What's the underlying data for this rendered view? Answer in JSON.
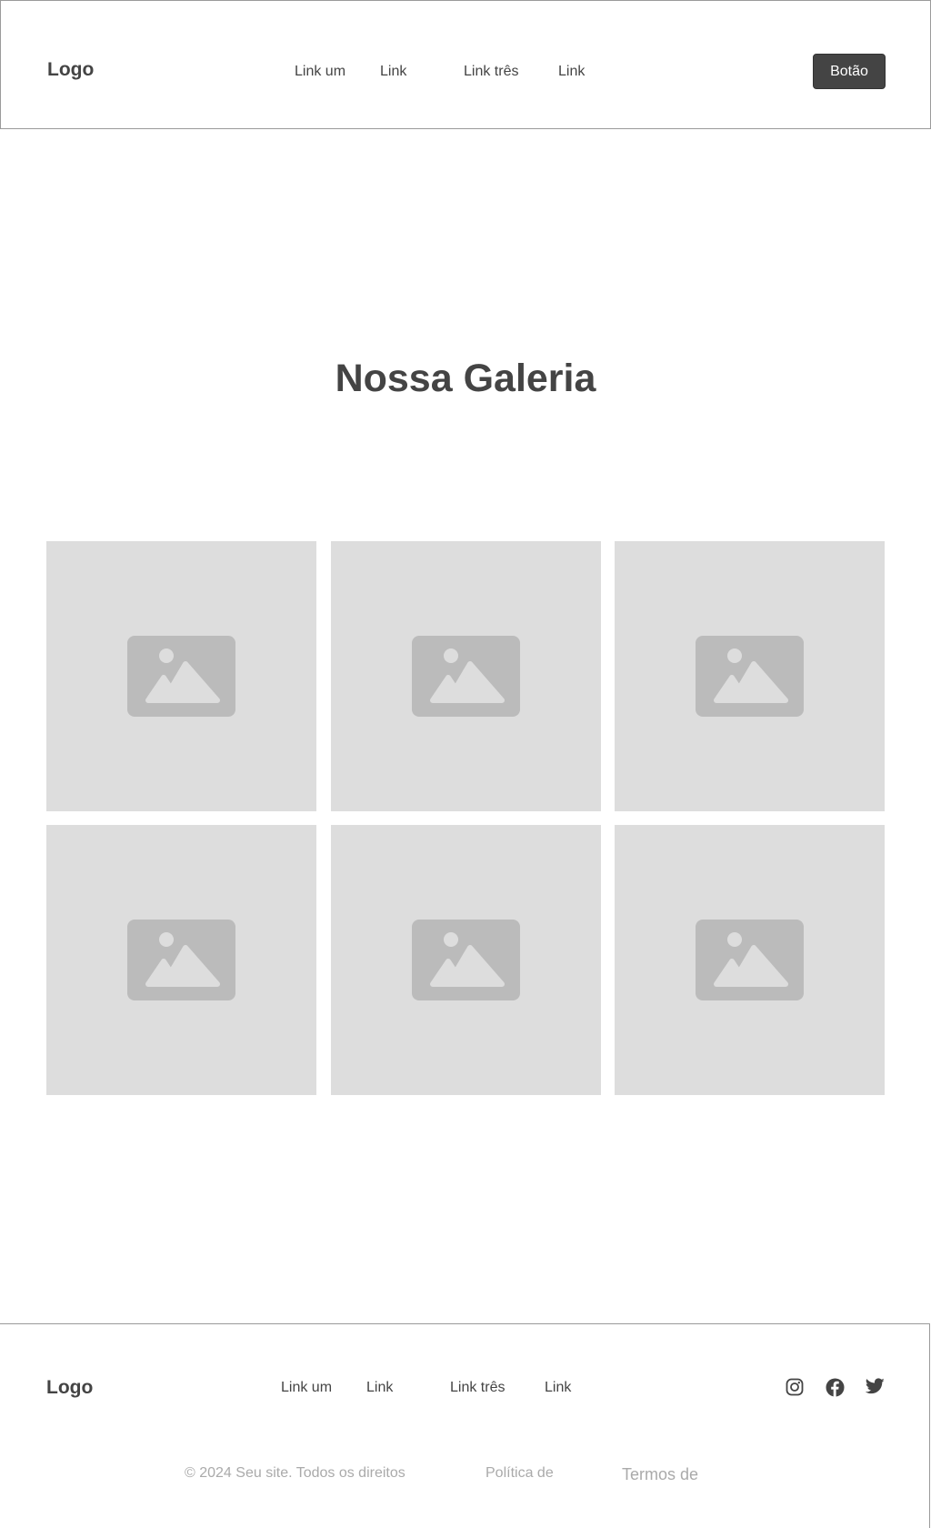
{
  "header": {
    "logo": "Logo",
    "nav": [
      "Link um",
      "Link",
      "Link três",
      "Link"
    ],
    "button": "Botão"
  },
  "main": {
    "title": "Nossa Galeria",
    "gallery_icon": "image-placeholder-icon"
  },
  "footer": {
    "logo": "Logo",
    "nav": [
      "Link um",
      "Link",
      "Link três",
      "Link"
    ],
    "social_icons": [
      "instagram-icon",
      "facebook-icon",
      "twitter-icon"
    ],
    "copyright": "© 2024 Seu site. Todos os direitos",
    "privacy": "Política de",
    "terms": "Termos de"
  },
  "colors": {
    "text": "#444444",
    "button_bg": "#444444",
    "placeholder_bg": "#dddddd",
    "placeholder_icon": "#bbbbbb",
    "muted_text": "#aaaaaa"
  }
}
